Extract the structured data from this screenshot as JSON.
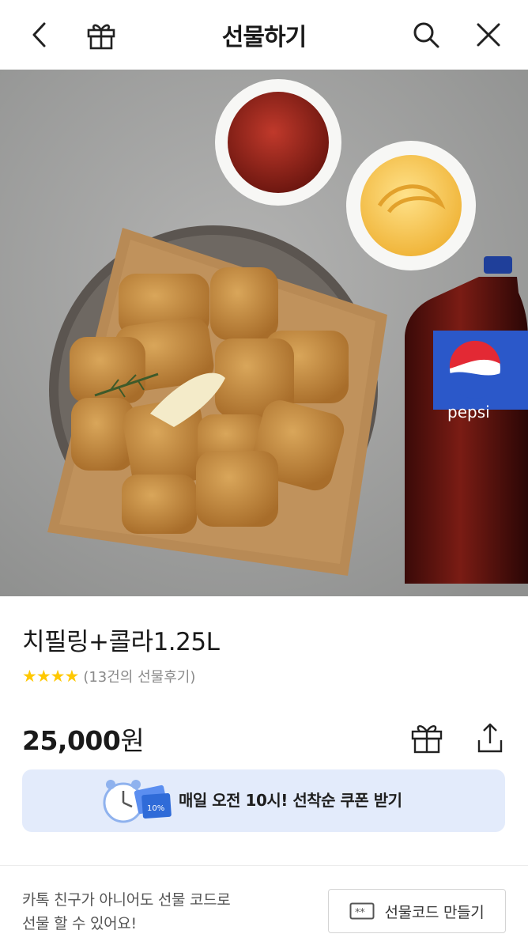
{
  "header": {
    "title": "선물하기",
    "back_icon": "chevron-left-icon",
    "gift_icon": "gift-icon",
    "search_icon": "search-icon",
    "close_icon": "close-icon"
  },
  "product": {
    "name": "치필링+콜라1.25L",
    "stars": "★★★★",
    "review_text": "(13건의 선물후기)",
    "rating": 4,
    "price": "25,000",
    "price_unit": "원"
  },
  "hero_image": {
    "bottle_label": "pepsi"
  },
  "coupon": {
    "text": "매일 오전 10시! 선착순 쿠폰 받기",
    "ticket_text": "10%"
  },
  "footer": {
    "note_line1": "카톡 친구가 아니어도 선물 코드로",
    "note_line2": "선물 할 수 있어요!",
    "code_button_label": "선물코드 만들기"
  },
  "colors": {
    "accent": "#2f6bd8",
    "coupon_bg": "#e3ebfb",
    "star": "#ffc800"
  }
}
